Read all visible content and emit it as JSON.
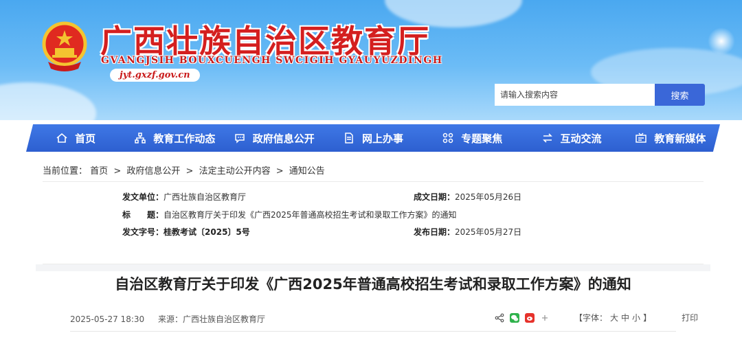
{
  "header": {
    "title": "广西壮族自治区教育厅",
    "subtitle": "GVANGJSIH BOUXCUENGH SWCIGIH GYAUYUZDINGH",
    "url": "jyt.gxzf.gov.cn",
    "search": {
      "placeholder": "请输入搜索内容",
      "button": "搜索"
    }
  },
  "nav": {
    "items": [
      {
        "label": "首页",
        "icon": "home-icon"
      },
      {
        "label": "教育工作动态",
        "icon": "org-chart-icon"
      },
      {
        "label": "政府信息公开",
        "icon": "chat-bubble-icon"
      },
      {
        "label": "网上办事",
        "icon": "document-icon"
      },
      {
        "label": "专题聚焦",
        "icon": "grid-icon"
      },
      {
        "label": "互动交流",
        "icon": "exchange-icon"
      },
      {
        "label": "教育新媒体",
        "icon": "media-icon"
      }
    ]
  },
  "breadcrumb": {
    "prefix": "当前位置：",
    "items": [
      "首页",
      "政府信息公开",
      "法定主动公开内容",
      "通知公告"
    ],
    "separator": ">"
  },
  "meta": {
    "issuer_label": "发文单位：",
    "issuer": "广西壮族自治区教育厅",
    "date_label": "成文日期：",
    "date": "2025年05月26日",
    "title_label": "标　　题：",
    "title": "自治区教育厅关于印发《广西2025年普通高校招生考试和录取工作方案》的通知",
    "doc_no_label": "发文字号：",
    "doc_no": "桂教考试〔2025〕5号",
    "publish_label": "发布日期：",
    "publish_date": "2025年05月27日"
  },
  "article": {
    "title": "自治区教育厅关于印发《广西2025年普通高校招生考试和录取工作方案》的通知",
    "datetime": "2025-05-27 18:30",
    "source_label": "来源：",
    "source": "广西壮族自治区教育厅",
    "font_label_open": "【字体：",
    "font_large": "大",
    "font_medium": "中",
    "font_small": "小",
    "font_label_close": "】",
    "print": "打印"
  },
  "colors": {
    "brand_red": "#d41f1f",
    "nav_blue": "#3a67d8",
    "banner_sky": "#6cbcf6"
  }
}
